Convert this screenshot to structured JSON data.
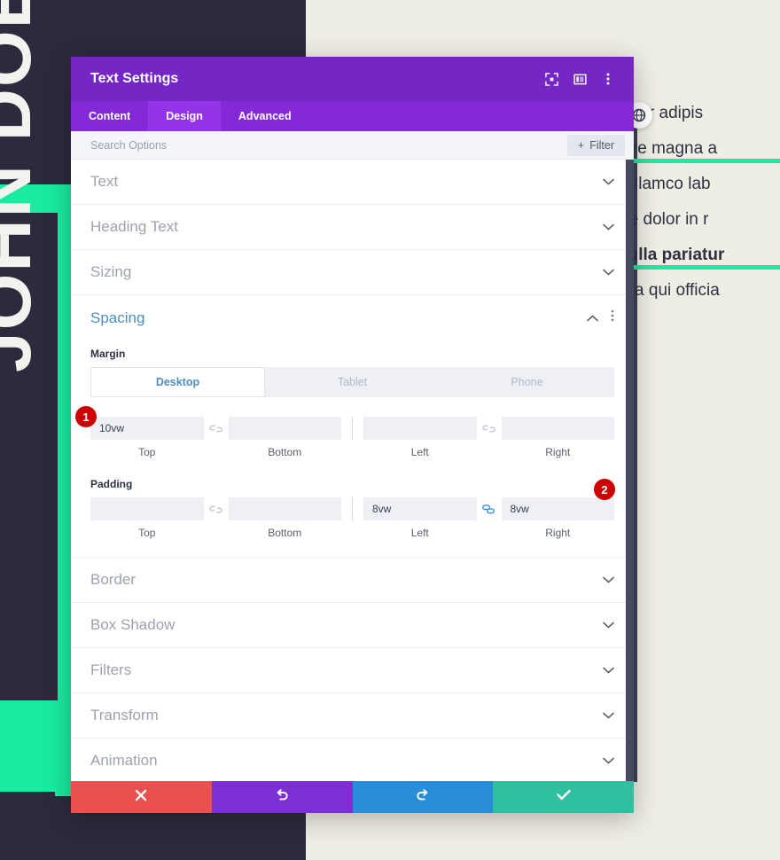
{
  "background": {
    "vertical_name": "JOHN DOE",
    "accent_color": "#1aeba0",
    "dark_color": "#2b2b3d",
    "cream_color": "#efeee5",
    "round_button_icon": "settings-globe-icon",
    "article_lines": [
      {
        "text": "consectetur adipis",
        "highlight": false,
        "bold": false
      },
      {
        "text": "e et dolore magna a",
        "highlight": true,
        "bold": false
      },
      {
        "text": "citation  ullamco  lab",
        "highlight": false,
        "bold": false
      },
      {
        "text": "aute irure dolor in r",
        "highlight": false,
        "bold": false
      },
      {
        "text": "fugiat nulla pariatur",
        "highlight": true,
        "bold": true
      },
      {
        "text": "nt in culpa qui officia",
        "highlight": false,
        "bold": false
      }
    ]
  },
  "modal": {
    "title": "Text Settings",
    "header_color": "#7427c4",
    "tabs_color": "#8429d8",
    "title_icons": [
      {
        "name": "focus-icon"
      },
      {
        "name": "layout-panel-icon"
      },
      {
        "name": "more-vertical-icon"
      }
    ],
    "tabs": [
      {
        "label": "Content",
        "active": false
      },
      {
        "label": "Design",
        "active": true
      },
      {
        "label": "Advanced",
        "active": false
      }
    ],
    "search": {
      "value": "",
      "placeholder": "Search Options",
      "filter_label": "Filter",
      "filter_plus": "+"
    },
    "sections_before": [
      {
        "label": "Text"
      },
      {
        "label": "Heading Text"
      },
      {
        "label": "Sizing"
      }
    ],
    "spacing": {
      "title": "Spacing",
      "title_color": "#4c8fbe",
      "expanded": true,
      "margin": {
        "label": "Margin",
        "devices": [
          {
            "label": "Desktop",
            "active": true
          },
          {
            "label": "Tablet",
            "active": false
          },
          {
            "label": "Phone",
            "active": false
          }
        ],
        "fields": [
          {
            "caption": "Top",
            "value": "10vw",
            "placeholder": ""
          },
          {
            "caption": "Bottom",
            "value": "",
            "placeholder": ""
          },
          {
            "caption": "Left",
            "value": "",
            "placeholder": ""
          },
          {
            "caption": "Right",
            "value": "",
            "placeholder": ""
          }
        ],
        "link_left": {
          "name": "link-broken-icon",
          "linked": false
        },
        "link_right": {
          "name": "link-broken-icon",
          "linked": false
        }
      },
      "padding": {
        "label": "Padding",
        "fields": [
          {
            "caption": "Top",
            "value": "",
            "placeholder": ""
          },
          {
            "caption": "Bottom",
            "value": "",
            "placeholder": ""
          },
          {
            "caption": "Left",
            "value": "8vw",
            "placeholder": ""
          },
          {
            "caption": "Right",
            "value": "8vw",
            "placeholder": ""
          }
        ],
        "link_left": {
          "name": "link-broken-icon",
          "linked": false
        },
        "link_right": {
          "name": "link-connected-icon",
          "linked": true
        }
      }
    },
    "sections_after": [
      {
        "label": "Border"
      },
      {
        "label": "Box Shadow"
      },
      {
        "label": "Filters"
      },
      {
        "label": "Transform"
      },
      {
        "label": "Animation"
      }
    ],
    "footer": [
      {
        "name": "cancel-button",
        "icon": "close-icon",
        "color": "#e8514f"
      },
      {
        "name": "undo-button",
        "icon": "undo-icon",
        "color": "#7b2fd4"
      },
      {
        "name": "redo-button",
        "icon": "redo-icon",
        "color": "#2a8ed6"
      },
      {
        "name": "save-button",
        "icon": "checkmark-icon",
        "color": "#2fc0a0"
      }
    ]
  },
  "annotations": [
    {
      "number": "1",
      "target": "margin-top-field"
    },
    {
      "number": "2",
      "target": "padding-right-field"
    }
  ]
}
